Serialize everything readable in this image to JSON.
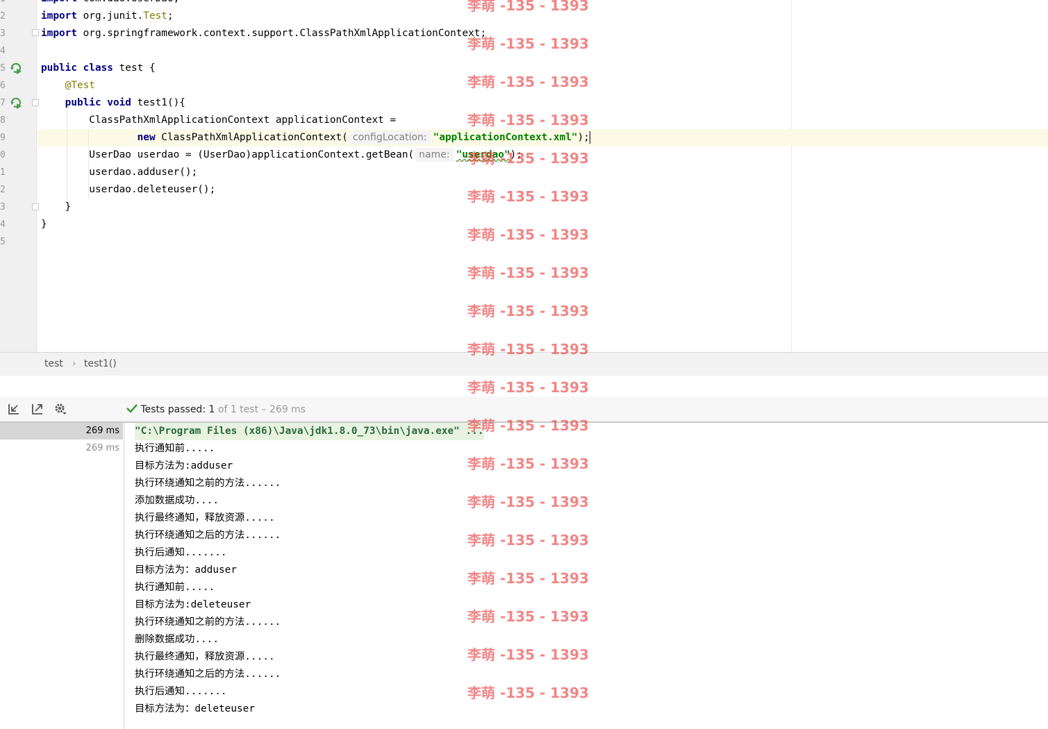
{
  "editor": {
    "line_numbers": [
      "1",
      "2",
      "3",
      "4",
      "5",
      "6",
      "7",
      "8",
      "9",
      "0",
      "1",
      "2",
      "3",
      "4",
      "5"
    ],
    "lines": [
      {
        "tokens": [
          {
            "t": "kw",
            "v": "import"
          },
          {
            "t": "plain",
            "v": " com.dao.UserDao;"
          }
        ]
      },
      {
        "tokens": [
          {
            "t": "kw",
            "v": "import"
          },
          {
            "t": "plain",
            "v": " org.junit."
          },
          {
            "t": "ann",
            "v": "Test"
          },
          {
            "t": "plain",
            "v": ";"
          }
        ]
      },
      {
        "tokens": [
          {
            "t": "kw",
            "v": "import"
          },
          {
            "t": "plain",
            "v": " org.springframework.context.support.ClassPathXmlApplicationContext;"
          }
        ]
      },
      {
        "tokens": []
      },
      {
        "tokens": [
          {
            "t": "kw",
            "v": "public class"
          },
          {
            "t": "plain",
            "v": " test {"
          }
        ]
      },
      {
        "tokens": [
          {
            "t": "plain",
            "v": "    "
          },
          {
            "t": "ann",
            "v": "@Test"
          }
        ]
      },
      {
        "tokens": [
          {
            "t": "plain",
            "v": "    "
          },
          {
            "t": "kw",
            "v": "public void"
          },
          {
            "t": "plain",
            "v": " test1(){"
          }
        ]
      },
      {
        "tokens": [
          {
            "t": "plain",
            "v": "        ClassPathXmlApplicationContext applicationContext ="
          }
        ]
      },
      {
        "tokens": [
          {
            "t": "plain",
            "v": "                "
          },
          {
            "t": "kw",
            "v": "new"
          },
          {
            "t": "plain",
            "v": " ClassPathXmlApplicationContext("
          },
          {
            "t": "hint",
            "v": "configLocation:"
          },
          {
            "t": "str",
            "v": "\"applicationContext.xml\""
          },
          {
            "t": "plain",
            "v": ");"
          },
          {
            "t": "caret",
            "v": ""
          }
        ]
      },
      {
        "tokens": [
          {
            "t": "plain",
            "v": "        UserDao userdao = (UserDao)applicationContext.getBean("
          },
          {
            "t": "hint",
            "v": "name:"
          },
          {
            "t": "strsq",
            "v": "\"userdao\""
          },
          {
            "t": "plain",
            "v": ");"
          }
        ]
      },
      {
        "tokens": [
          {
            "t": "plain",
            "v": "        userdao.adduser();"
          }
        ]
      },
      {
        "tokens": [
          {
            "t": "plain",
            "v": "        userdao.deleteuser();"
          }
        ]
      },
      {
        "tokens": [
          {
            "t": "plain",
            "v": "    }"
          }
        ]
      },
      {
        "tokens": [
          {
            "t": "plain",
            "v": "}"
          }
        ]
      },
      {
        "tokens": []
      }
    ]
  },
  "breadcrumb": {
    "items": [
      "test",
      "test1()"
    ],
    "separator": "›"
  },
  "test_toolbar": {
    "status_label": "Tests passed:",
    "status_count": "1",
    "status_detail": "of 1 test – 269 ms"
  },
  "test_tree": [
    {
      "duration": "269 ms",
      "selected": true
    },
    {
      "duration": "269 ms",
      "selected": false
    }
  ],
  "console": {
    "command": "\"C:\\Program Files (x86)\\Java\\jdk1.8.0_73\\bin\\java.exe\" ...",
    "lines": [
      "执行通知前.....",
      "目标方法为:adduser",
      "执行环绕通知之前的方法......",
      "添加数据成功....",
      "执行最终通知，释放资源.....",
      "执行环绕通知之后的方法......",
      "执行后通知.......",
      "目标方法为：adduser",
      "执行通知前.....",
      "目标方法为:deleteuser",
      "执行环绕通知之前的方法......",
      "删除数据成功....",
      "执行最终通知，释放资源.....",
      "执行环绕通知之后的方法......",
      "执行后通知.......",
      "目标方法为：deleteuser"
    ]
  },
  "watermark": {
    "text": "李萌 -135 - 1393",
    "count": 19
  },
  "colors": {
    "keyword": "#000080",
    "annotation": "#808000",
    "string": "#008000",
    "success": "#3a9a3a",
    "watermark": "#e63c3c"
  }
}
